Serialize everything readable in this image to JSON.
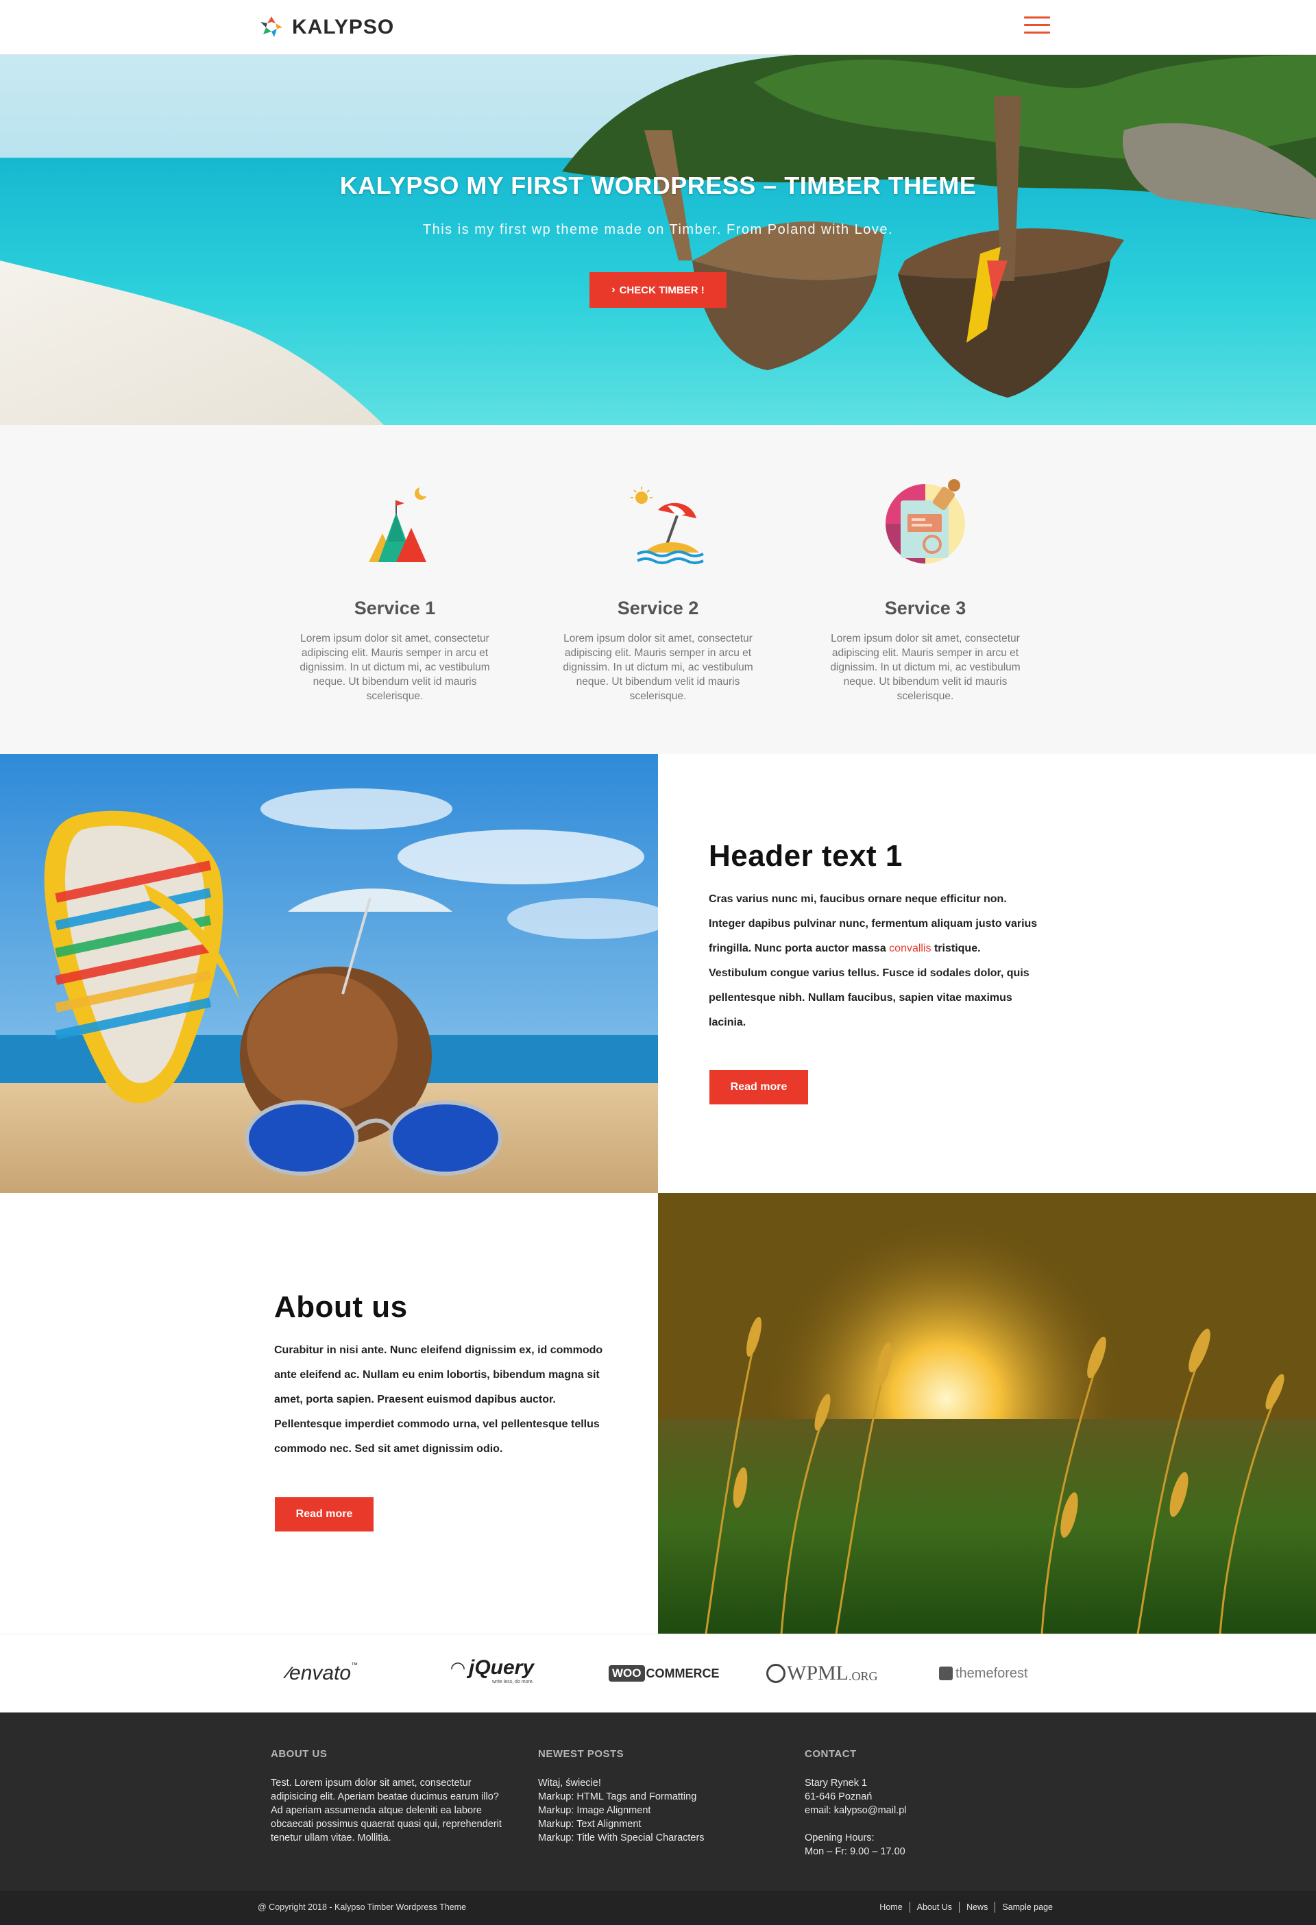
{
  "brand": {
    "name": "KALYPSO",
    "accent": "#e8392b"
  },
  "hero": {
    "title": "KALYPSO MY FIRST WORDPRESS – TIMBER THEME",
    "subtitle": "This is my first wp theme made on Timber. From Poland with Love.",
    "button_label": "CHECK TIMBER !",
    "button_icon": "chevron-right-icon"
  },
  "services": [
    {
      "title": "Service 1",
      "icon": "mountains-icon",
      "text": "Lorem ipsum dolor sit amet, consectetur adipiscing elit. Mauris semper in arcu et dignissim. In ut dictum mi, ac vestibulum neque. Ut bibendum velit id mauris scelerisque."
    },
    {
      "title": "Service 2",
      "icon": "beach-umbrella-icon",
      "text": "Lorem ipsum dolor sit amet, consectetur adipiscing elit. Mauris semper in arcu et dignissim. In ut dictum mi, ac vestibulum neque. Ut bibendum velit id mauris scelerisque."
    },
    {
      "title": "Service 3",
      "icon": "passport-stamp-icon",
      "text": "Lorem ipsum dolor sit amet, consectetur adipiscing elit. Mauris semper in arcu et dignissim. In ut dictum mi, ac vestibulum neque. Ut bibendum velit id mauris scelerisque."
    }
  ],
  "feature1": {
    "heading": "Header text 1",
    "body_before": "Cras varius nunc mi, faucibus ornare neque efficitur non. Integer dapibus pulvinar nunc, fermentum aliquam justo varius fringilla. Nunc porta auctor massa ",
    "body_link": "convallis",
    "body_after": " tristique. Vestibulum congue varius tellus. Fusce id sodales dolor, quis pellentesque nibh. Nullam faucibus, sapien vitae maximus lacinia.",
    "button_label": "Read more"
  },
  "about": {
    "heading": "About us",
    "body": "Curabitur in nisi ante. Nunc eleifend dignissim ex, id commodo ante eleifend ac. Nullam eu enim lobortis, bibendum magna sit amet, porta sapien. Praesent euismod dapibus auctor. Pellentesque imperdiet commodo urna, vel pellentesque tellus commodo nec. Sed sit amet dignissim odio.",
    "button_label": "Read more"
  },
  "partners": [
    {
      "name": "envato",
      "mark": "™"
    },
    {
      "name": "jQuery",
      "tagline": "write less, do more."
    },
    {
      "name_box": "WOO",
      "name_rest": "COMMERCE"
    },
    {
      "name": "WPML",
      "suffix": ".ORG"
    },
    {
      "name": "themeforest"
    }
  ],
  "footer": {
    "about": {
      "title": "ABOUT US",
      "text": "Test. Lorem ipsum dolor sit amet, consectetur adipisicing elit. Aperiam beatae ducimus earum illo? Ad aperiam assumenda atque deleniti ea labore obcaecati possimus quaerat quasi qui, reprehenderit tenetur ullam vitae. Mollitia."
    },
    "posts": {
      "title": "NEWEST POSTS",
      "items": [
        "Witaj, świecie!",
        "Markup: HTML Tags and Formatting",
        "Markup: Image Alignment",
        "Markup: Text Alignment",
        "Markup: Title With Special Characters"
      ]
    },
    "contact": {
      "title": "CONTACT",
      "street": "Stary Rynek 1",
      "city": "61-646 Poznań",
      "email": "email: kalypso@mail.pl",
      "hours_label": "Opening Hours:",
      "hours": "Mon – Fr: 9.00 – 17.00"
    }
  },
  "bottom": {
    "copyright": "@ Copyright 2018 - Kalypso Timber Wordpress Theme",
    "links": [
      "Home",
      "About Us",
      "News",
      "Sample page"
    ]
  }
}
